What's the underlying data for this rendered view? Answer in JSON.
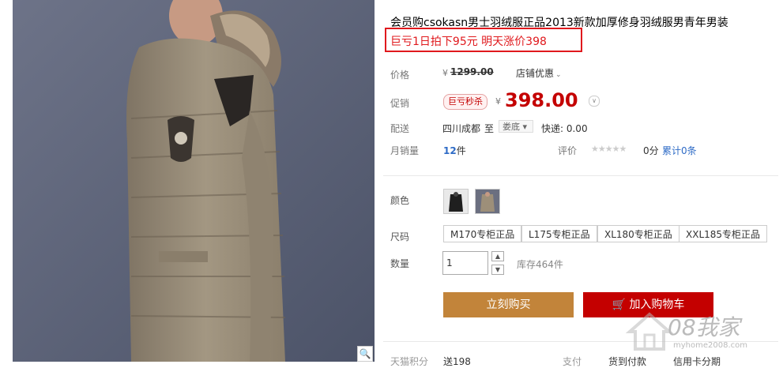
{
  "product": {
    "title": "会员购csokasn男士羽绒服正品2013新款加厚修身羽绒服男青年男装",
    "promo": "巨亏1日拍下95元 明天涨价398"
  },
  "labels": {
    "price": "价格",
    "promo": "促销",
    "shipping": "配送",
    "monthly_sales": "月销量",
    "rating": "评价",
    "color": "颜色",
    "size": "尺码",
    "quantity": "数量"
  },
  "price": {
    "currency": "¥",
    "original": "1299.00",
    "coupon": "店铺优惠",
    "sale_badge": "巨亏秒杀",
    "current": "398.00"
  },
  "shipping": {
    "from": "四川成都",
    "to_word": "至",
    "destination": "娄底",
    "express": "快递: 0.00"
  },
  "sales": {
    "count": "12",
    "unit": "件",
    "stars": "★★★★★",
    "score": "0分",
    "reviews": "累计0条"
  },
  "colors": [
    {
      "icon": "black-jacket-thumbnail"
    },
    {
      "icon": "khaki-jacket-thumbnail"
    }
  ],
  "sizes": [
    "M170专柜正品",
    "L175专柜正品",
    "XL180专柜正品",
    "XXL185专柜正品"
  ],
  "quantity": {
    "value": "1",
    "stock": "库存464件"
  },
  "buttons": {
    "buy_now": "立刻购买",
    "add_cart": "加入购物车"
  },
  "bottom": {
    "item1": "天猫积分",
    "item2": "送198",
    "item3": "支付",
    "item4": "货到付款",
    "item5": "信用卡分期"
  },
  "watermark": {
    "logo": "08我家",
    "url": "myhome2008.com"
  },
  "colors_theme": {
    "accent_red": "#c40000",
    "promo_red": "#e0191d",
    "buy_orange": "#c2843a",
    "link_blue": "#2e6bc6"
  },
  "icons": {
    "zoom": "magnifier-icon",
    "cart": "cart-icon"
  }
}
